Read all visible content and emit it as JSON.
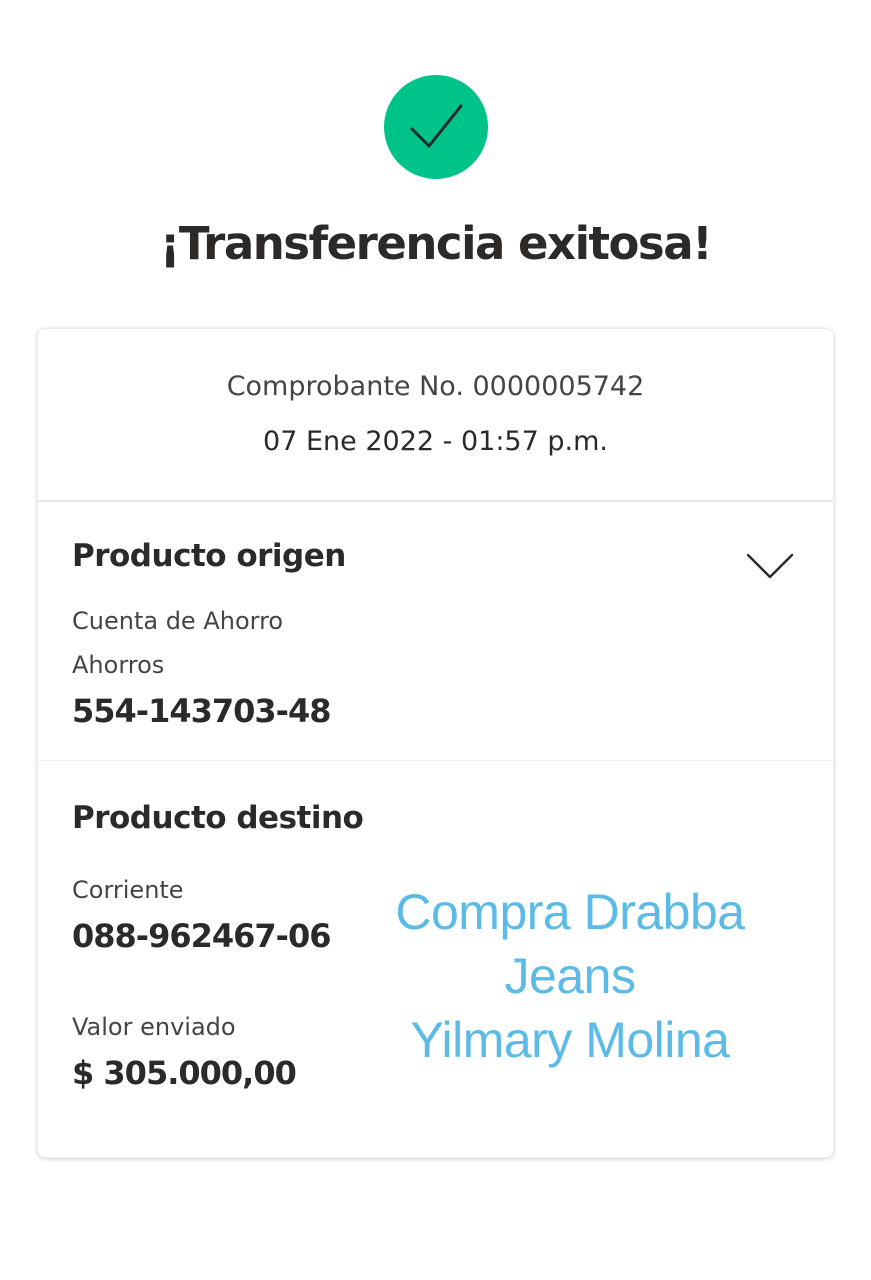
{
  "status": {
    "icon": "check-icon",
    "color": "#00c389",
    "title": "¡Transferencia exitosa!"
  },
  "voucher": {
    "number_text": "Comprobante No. 0000005742",
    "datetime": "07 Ene 2022 - 01:57 p.m."
  },
  "origin": {
    "title": "Producto origen",
    "chevron_icon": "chevron-down-icon",
    "account_type": "Cuenta de Ahorro",
    "product_type": "Ahorros",
    "account_number": "554-143703-48"
  },
  "destination": {
    "title": "Producto destino",
    "account_type": "Corriente",
    "account_number": "088-962467-06",
    "amount_label": "Valor enviado",
    "amount": "$ 305.000,00"
  },
  "overlay_note": {
    "line1": "Compra Drabba",
    "line2": "Jeans",
    "line3": "Yilmary Molina",
    "color": "#5bbbe6"
  }
}
